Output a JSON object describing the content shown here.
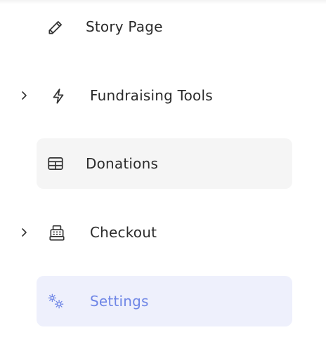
{
  "nav": {
    "items": [
      {
        "label": "Story Page",
        "icon": "pencil-icon"
      },
      {
        "label": "Fundraising Tools",
        "icon": "lightning-icon",
        "expandable": true
      },
      {
        "label": "Donations",
        "icon": "table-icon",
        "highlight": "hover"
      },
      {
        "label": "Checkout",
        "icon": "cash-register-icon",
        "expandable": true
      },
      {
        "label": "Settings",
        "icon": "gears-icon",
        "highlight": "active"
      }
    ]
  },
  "colors": {
    "text": "#2b2b2b",
    "active_text": "#6f86e6",
    "active_bg": "#eef0fc",
    "hover_bg": "#f5f5f5"
  }
}
